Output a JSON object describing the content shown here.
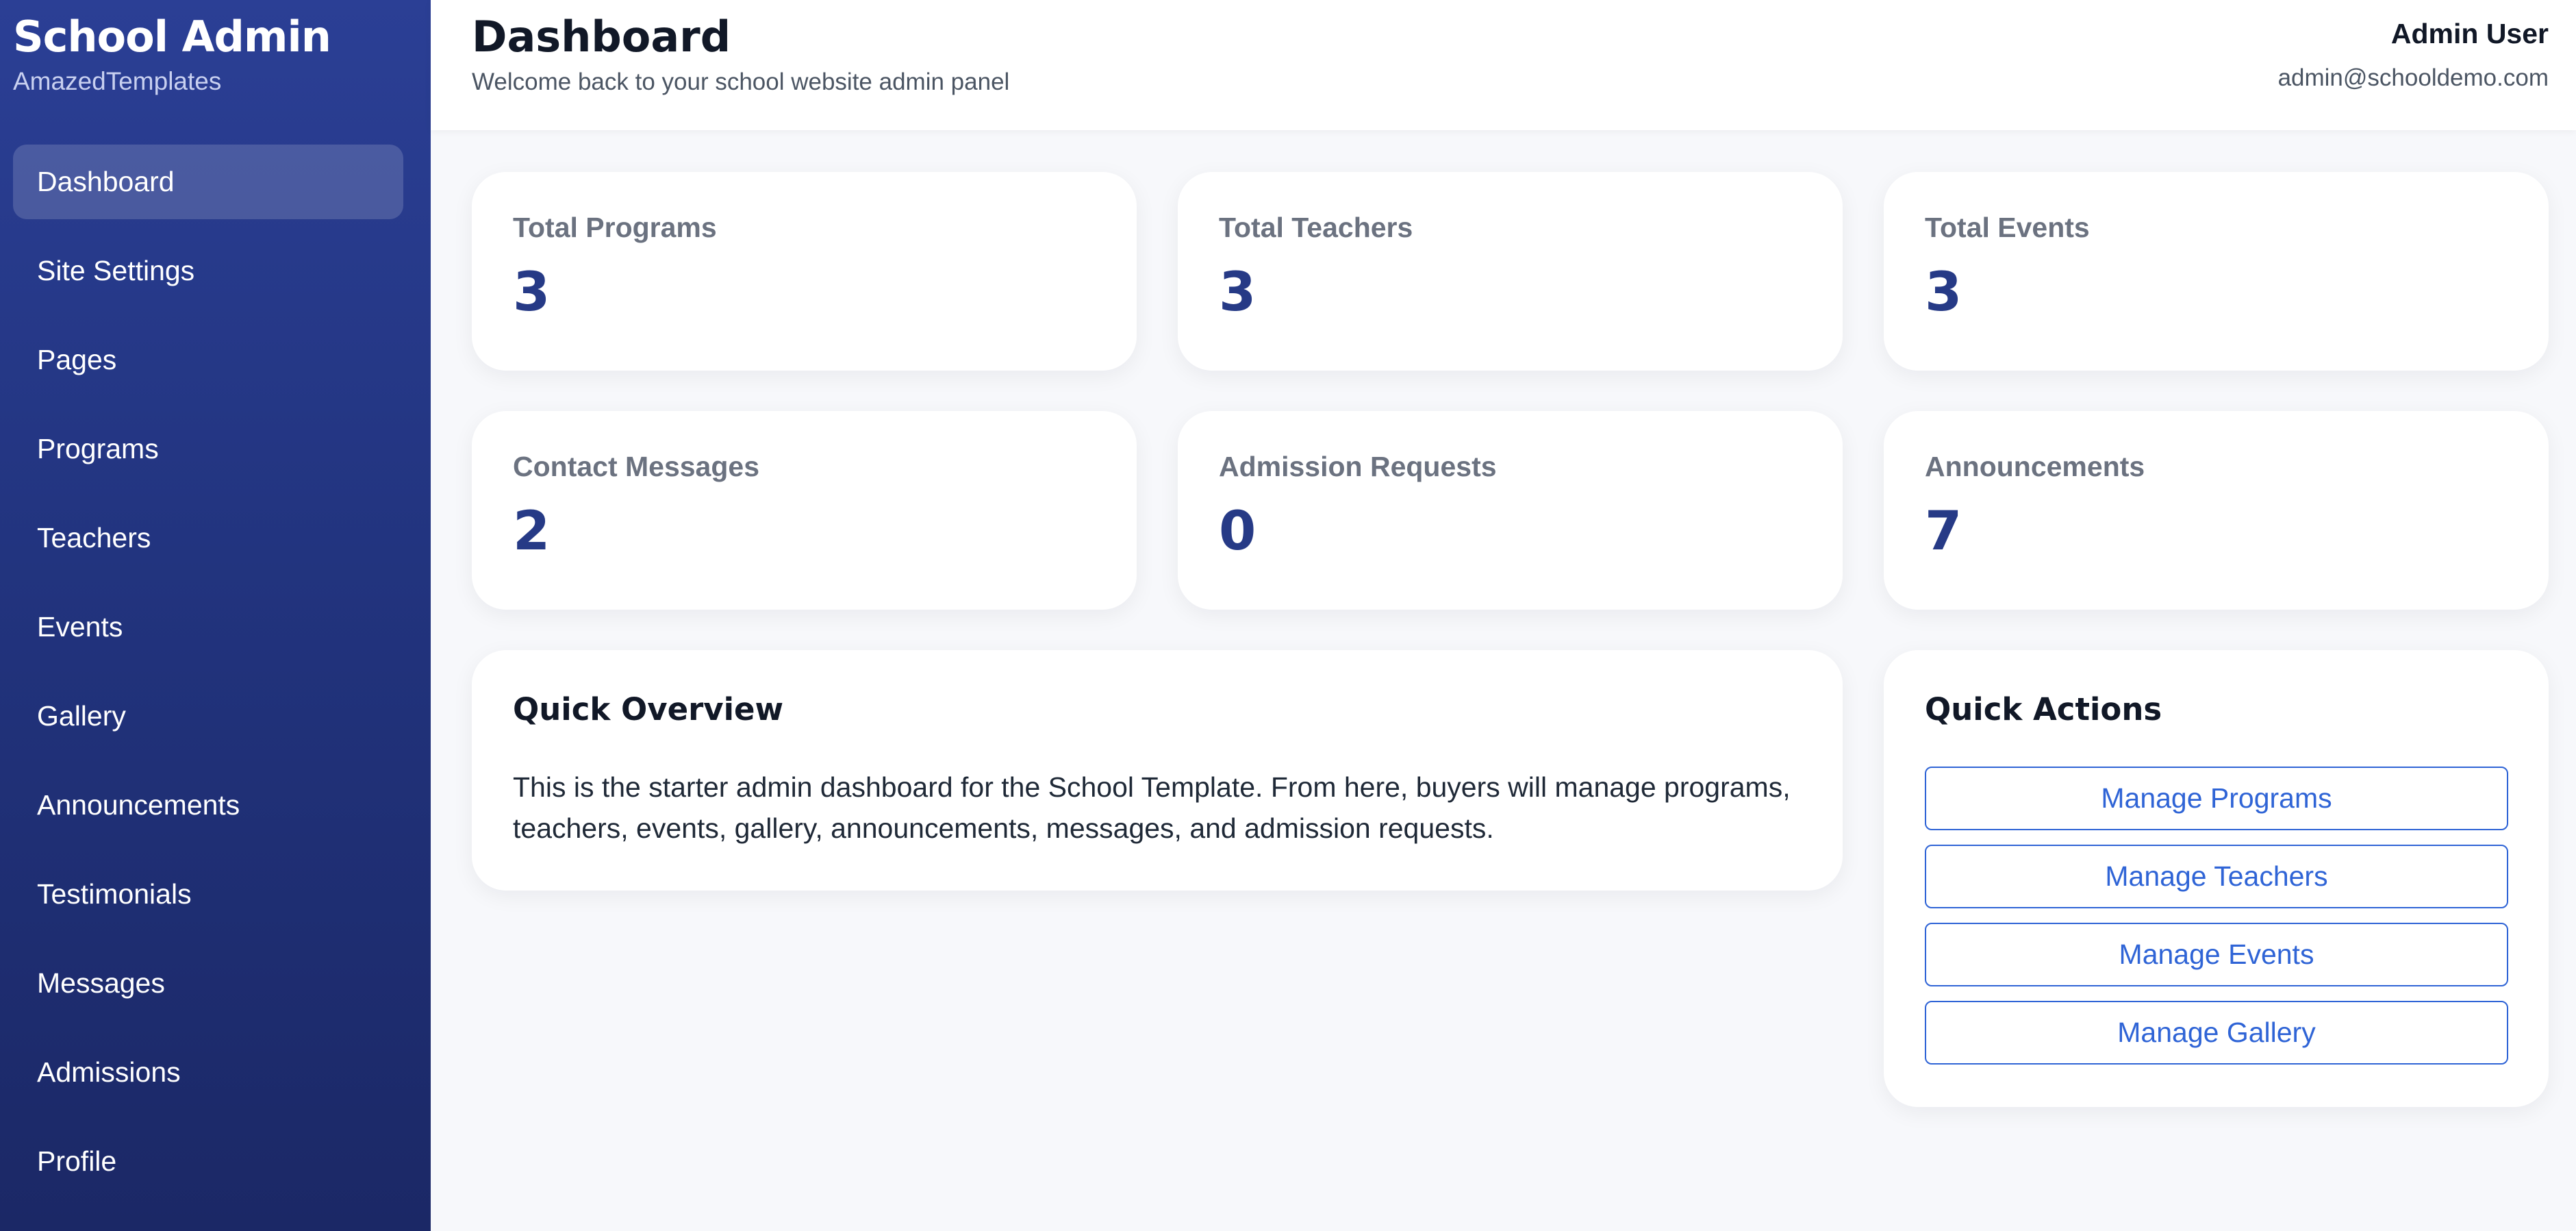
{
  "sidebar": {
    "title": "School Admin",
    "subtitle": "AmazedTemplates",
    "items": [
      {
        "label": "Dashboard",
        "active": true
      },
      {
        "label": "Site Settings"
      },
      {
        "label": "Pages"
      },
      {
        "label": "Programs"
      },
      {
        "label": "Teachers"
      },
      {
        "label": "Events"
      },
      {
        "label": "Gallery"
      },
      {
        "label": "Announcements"
      },
      {
        "label": "Testimonials"
      },
      {
        "label": "Messages"
      },
      {
        "label": "Admissions"
      },
      {
        "label": "Profile"
      }
    ]
  },
  "header": {
    "title": "Dashboard",
    "subtitle": "Welcome back to your school website admin panel",
    "user_name": "Admin User",
    "user_email": "admin@schooldemo.com"
  },
  "stats": [
    {
      "label": "Total Programs",
      "value": "3"
    },
    {
      "label": "Total Teachers",
      "value": "3"
    },
    {
      "label": "Total Events",
      "value": "3"
    },
    {
      "label": "Contact Messages",
      "value": "2"
    },
    {
      "label": "Admission Requests",
      "value": "0"
    },
    {
      "label": "Announcements",
      "value": "7"
    }
  ],
  "overview": {
    "title": "Quick Overview",
    "text": "This is the starter admin dashboard for the School Template. From here, buyers will manage programs, teachers, events, gallery, announcements, messages, and admission requests."
  },
  "quick_actions": {
    "title": "Quick Actions",
    "buttons": [
      {
        "label": "Manage Programs"
      },
      {
        "label": "Manage Teachers"
      },
      {
        "label": "Manage Events"
      },
      {
        "label": "Manage Gallery"
      }
    ]
  },
  "colors": {
    "sidebar": "#2b3f95",
    "accent": "#263a86",
    "link": "#2f64d6"
  }
}
